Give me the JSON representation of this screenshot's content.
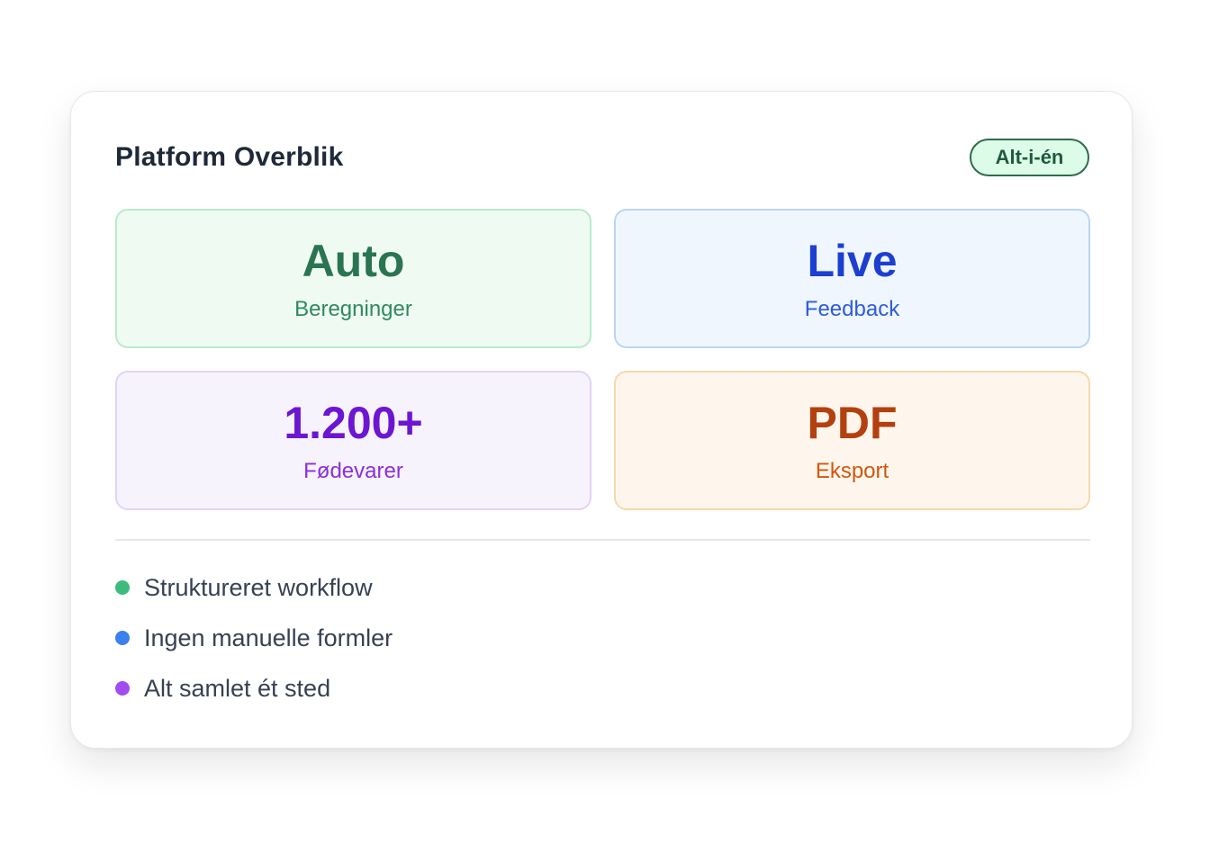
{
  "card": {
    "title": "Platform Overblik",
    "badge": "Alt-i-én"
  },
  "stats": [
    {
      "value": "Auto",
      "label": "Beregninger",
      "color": "#2b7452"
    },
    {
      "value": "Live",
      "label": "Feedback",
      "color": "#1d3fd0"
    },
    {
      "value": "1.200+",
      "label": "Fødevarer",
      "color": "#6d16d1"
    },
    {
      "value": "PDF",
      "label": "Eksport",
      "color": "#b3400f"
    }
  ],
  "features": [
    {
      "text": "Struktureret workflow",
      "dot_color": "#3dbb7a"
    },
    {
      "text": "Ingen manuelle formler",
      "dot_color": "#3b7ff0"
    },
    {
      "text": "Alt samlet ét sted",
      "dot_color": "#a24cf0"
    }
  ]
}
